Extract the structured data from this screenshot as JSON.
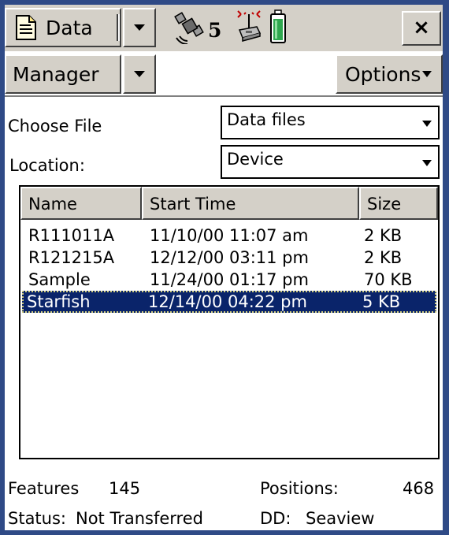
{
  "topbar": {
    "app_title": "Data",
    "satellite_count": "5",
    "close_label": "×",
    "icons": [
      "document-icon",
      "satellite-icon",
      "gps-receiver-icon",
      "battery-icon"
    ]
  },
  "menubar": {
    "manager_label": "Manager",
    "options_label": "Options"
  },
  "form": {
    "choose_file_label": "Choose File",
    "choose_file_value": "Data files",
    "location_label": "Location:",
    "location_value": "Device"
  },
  "filelist": {
    "columns": [
      "Name",
      "Start Time",
      "Size"
    ],
    "rows": [
      {
        "name": "R111011A",
        "start_time": "11/10/00 11:07 am",
        "size": "2 KB",
        "selected": false
      },
      {
        "name": "R121215A",
        "start_time": "12/12/00 03:11 pm",
        "size": "2 KB",
        "selected": false
      },
      {
        "name": "Sample",
        "start_time": "11/24/00 01:17 pm",
        "size": "70 KB",
        "selected": false
      },
      {
        "name": "Starfish",
        "start_time": "12/14/00 04:22 pm",
        "size": "5 KB",
        "selected": true
      }
    ]
  },
  "footer": {
    "features_label": "Features",
    "features_value": "145",
    "positions_label": "Positions:",
    "positions_value": "468",
    "status_label": "Status:",
    "status_value": "Not Transferred",
    "dd_label": "DD:",
    "dd_value": "Seaview"
  },
  "colors": {
    "frame": "#2f4a86",
    "chrome": "#d4d0c8",
    "selection": "#0a246a",
    "battery": "#2fa84f"
  }
}
